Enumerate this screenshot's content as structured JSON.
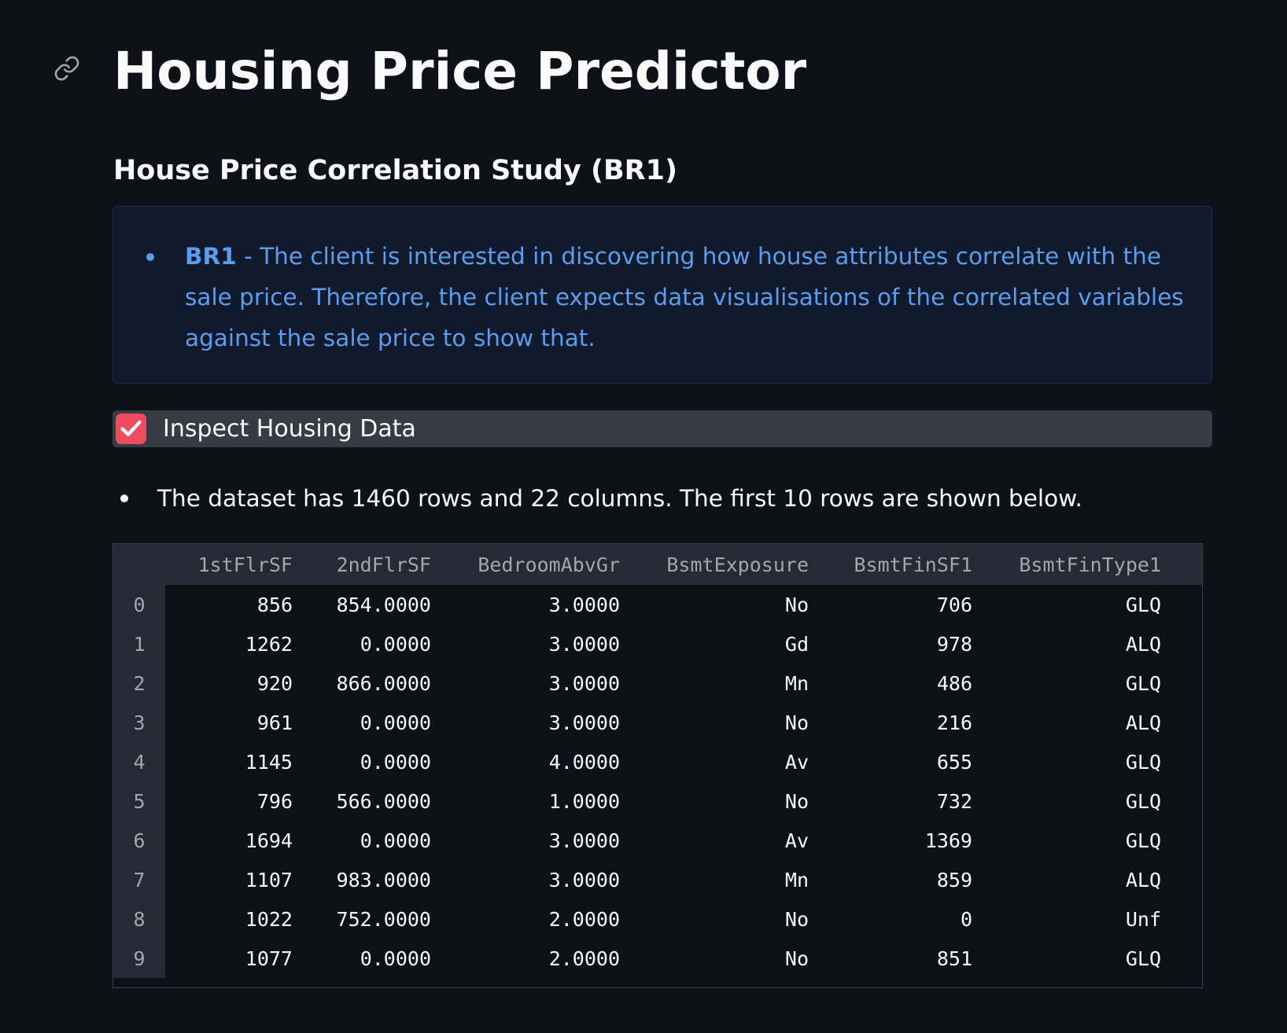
{
  "header": {
    "title": "Housing Price Predictor",
    "link_icon": "link-icon"
  },
  "section": {
    "title": "House Price Correlation Study (BR1)"
  },
  "info": {
    "label": "BR1",
    "separator": " - ",
    "text": "The client is interested in discovering how house attributes correlate with the sale price. Therefore, the client expects data visualisations of the correlated variables against the sale price to show that.",
    "color": "#5a9ded"
  },
  "checkbox": {
    "label": "Inspect Housing Data",
    "checked": true,
    "accent": "#ef4b5f",
    "icon": "check-icon"
  },
  "summary": {
    "text": "The dataset has 1460 rows and 22 columns. The first 10 rows are shown below."
  },
  "table": {
    "columns": [
      "1stFlrSF",
      "2ndFlrSF",
      "BedroomAbvGr",
      "BsmtExposure",
      "BsmtFinSF1",
      "BsmtFinType1"
    ],
    "rows": [
      [
        "0",
        "856",
        "854.0000",
        "3.0000",
        "No",
        "706",
        "GLQ"
      ],
      [
        "1",
        "1262",
        "0.0000",
        "3.0000",
        "Gd",
        "978",
        "ALQ"
      ],
      [
        "2",
        "920",
        "866.0000",
        "3.0000",
        "Mn",
        "486",
        "GLQ"
      ],
      [
        "3",
        "961",
        "0.0000",
        "3.0000",
        "No",
        "216",
        "ALQ"
      ],
      [
        "4",
        "1145",
        "0.0000",
        "4.0000",
        "Av",
        "655",
        "GLQ"
      ],
      [
        "5",
        "796",
        "566.0000",
        "1.0000",
        "No",
        "732",
        "GLQ"
      ],
      [
        "6",
        "1694",
        "0.0000",
        "3.0000",
        "Av",
        "1369",
        "GLQ"
      ],
      [
        "7",
        "1107",
        "983.0000",
        "3.0000",
        "Mn",
        "859",
        "ALQ"
      ],
      [
        "8",
        "1022",
        "752.0000",
        "2.0000",
        "No",
        "0",
        "Unf"
      ],
      [
        "9",
        "1077",
        "0.0000",
        "2.0000",
        "No",
        "851",
        "GLQ"
      ]
    ]
  }
}
